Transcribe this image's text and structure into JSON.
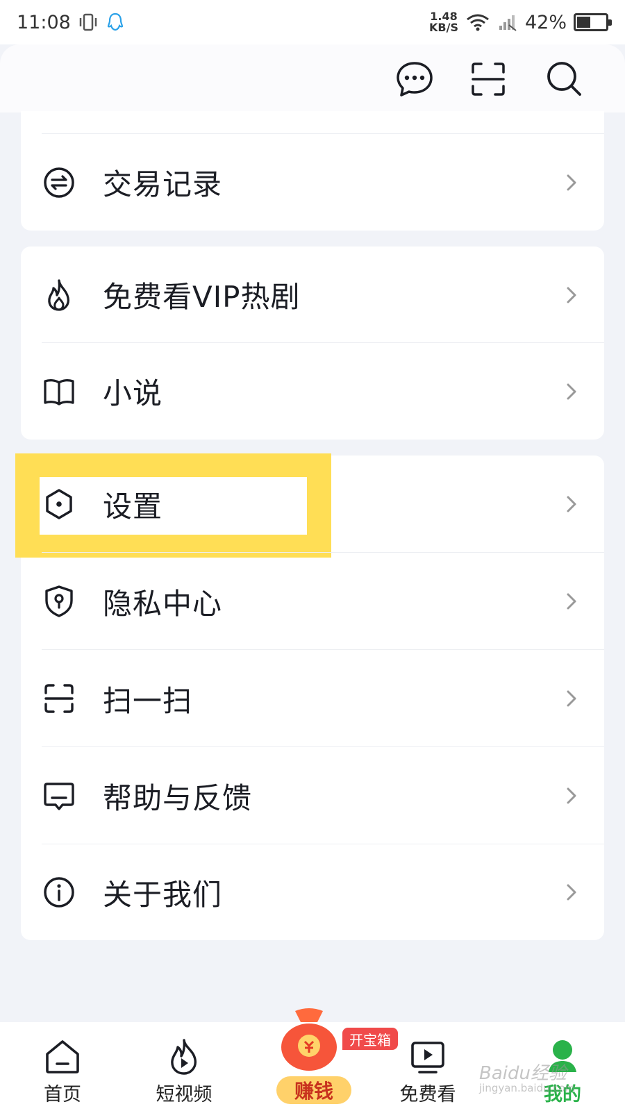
{
  "status_bar": {
    "time": "11:08",
    "net_speed_value": "1.48",
    "net_speed_unit": "KB/S",
    "battery": "42%"
  },
  "header": {
    "icons": [
      "message-icon",
      "scan-icon",
      "search-icon"
    ]
  },
  "menu": {
    "transaction": "交易记录",
    "free_vip": "免费看VIP热剧",
    "novel": "小说",
    "settings": "设置",
    "privacy": "隐私中心",
    "scan": "扫一扫",
    "help": "帮助与反馈",
    "about": "关于我们"
  },
  "bottom_nav": {
    "home": "首页",
    "short_video": "短视频",
    "earn": "赚钱",
    "earn_badge": "开宝箱",
    "free_watch": "免费看",
    "mine": "我的"
  },
  "watermark": {
    "brand": "Baidu经验",
    "url": "jingyan.baidu.com"
  },
  "colors": {
    "highlight": "#ffde55",
    "accent_green": "#2ab24a",
    "badge_red": "#f04a4a"
  }
}
